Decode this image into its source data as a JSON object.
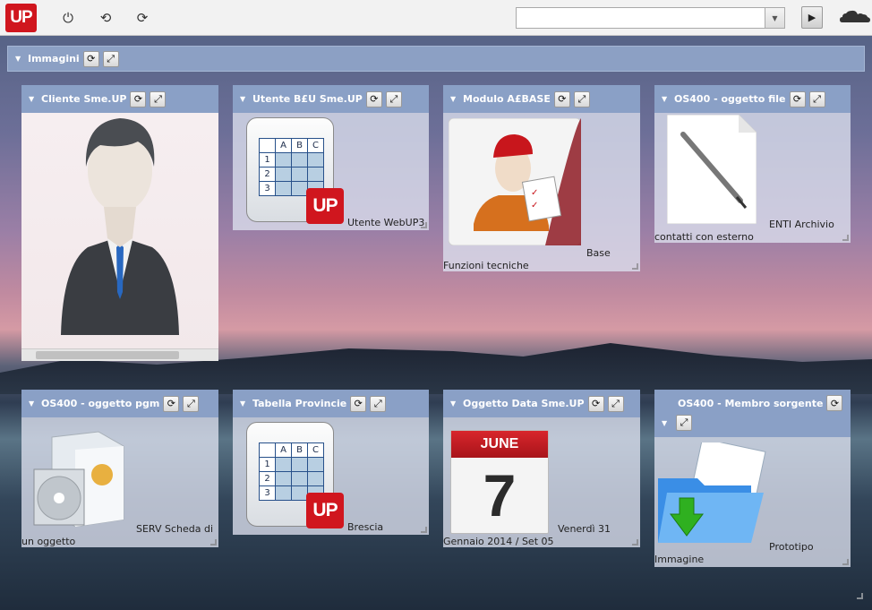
{
  "app": {
    "logo_text": "UP"
  },
  "toolbar": {
    "icons": [
      "power-icon",
      "undo-icon",
      "refresh-icon"
    ],
    "combo_value": "",
    "run_icon": "play-icon",
    "cloud_icon": "cloud-icon"
  },
  "section": {
    "title": "Immagini"
  },
  "panels": [
    {
      "title": "Cliente Sme.UP",
      "label_lines": []
    },
    {
      "title": "Utente B£U Sme.UP",
      "label_lines": [
        "Utente WebUP3"
      ]
    },
    {
      "title": "Modulo A£BASE",
      "label_lines": [
        "Base",
        "Funzioni tecniche"
      ]
    },
    {
      "title": "OS400 - oggetto file",
      "label_lines": [
        "ENTI Archivio",
        "contatti con esterno"
      ]
    },
    {
      "title": "OS400 - oggetto pgm",
      "label_lines": [
        "SERV Scheda di",
        "un oggetto"
      ]
    },
    {
      "title": "Tabella Provincie",
      "label_lines": [
        "Brescia"
      ]
    },
    {
      "title": "Oggetto Data Sme.UP",
      "label_lines": [
        "Venerdì 31",
        "Gennaio 2014 / Set 05"
      ]
    },
    {
      "title": "OS400 - Membro sorgente",
      "label_lines": [
        "Prototipo",
        "Immagine"
      ]
    }
  ],
  "grid_headers": [
    "A",
    "B",
    "C"
  ],
  "grid_rows": [
    "1",
    "2",
    "3"
  ],
  "calendar": {
    "month": "JUNE",
    "day": "7"
  }
}
